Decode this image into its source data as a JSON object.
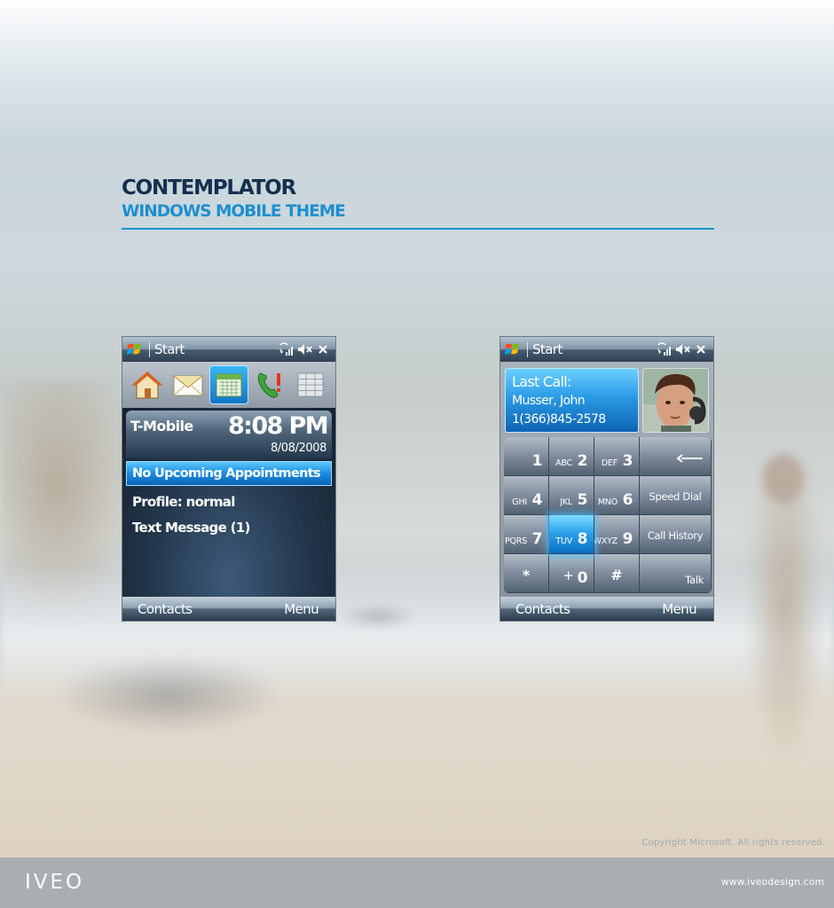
{
  "brand": {
    "title": "CONTEMPLATOR",
    "subtitle": "WINDOWS MOBILE THEME",
    "accent_color": "#1e8fce",
    "title_color": "#15304f"
  },
  "phone_left": {
    "titlebar": {
      "start_label": "Start",
      "icons": [
        "windows-flag-icon",
        "signal-icon",
        "volume-mute-icon",
        "close-icon"
      ]
    },
    "icon_strip": {
      "icons": [
        "home-icon",
        "mail-icon",
        "calendar-icon",
        "phone-alert-icon",
        "storage-icon"
      ],
      "selected": "calendar-icon"
    },
    "today": {
      "carrier": "T-Mobile",
      "time": "8:08 PM",
      "date": "8/08/2008",
      "highlight_item": "No Upcoming Appointments",
      "items": [
        "Profile: normal",
        "Text Message (1)"
      ]
    },
    "softkeys": {
      "left": "Contacts",
      "right": "Menu"
    }
  },
  "phone_right": {
    "titlebar": {
      "start_label": "Start",
      "icons": [
        "windows-flag-icon",
        "signal-icon",
        "volume-mute-icon",
        "close-icon"
      ]
    },
    "last_call": {
      "title": "Last Call:",
      "name": "Musser, John",
      "number": "1(366)845-2578"
    },
    "keypad": {
      "keys": [
        {
          "num": "1",
          "letters": ""
        },
        {
          "num": "2",
          "letters": "ABC"
        },
        {
          "num": "3",
          "letters": "DEF"
        },
        {
          "num": "4",
          "letters": "GHI"
        },
        {
          "num": "5",
          "letters": "JKL"
        },
        {
          "num": "6",
          "letters": "MNO"
        },
        {
          "num": "7",
          "letters": "PQRS"
        },
        {
          "num": "8",
          "letters": "TUV"
        },
        {
          "num": "9",
          "letters": "WXYZ"
        },
        {
          "num": "*",
          "letters": ""
        },
        {
          "num": "0",
          "letters": "+"
        },
        {
          "num": "#",
          "letters": ""
        }
      ],
      "selected_key": "8",
      "side_labels": {
        "speed_dial": "Speed Dial",
        "call_history": "Call History",
        "talk": "Talk"
      },
      "backspace_icon": "backspace-arrow-icon"
    },
    "softkeys": {
      "left": "Contacts",
      "right": "Menu"
    }
  },
  "copyright": "Copyright Microsoft. All rights reserved.",
  "footer": {
    "logo": "IVEO",
    "url": "www.iveodesign.com"
  }
}
